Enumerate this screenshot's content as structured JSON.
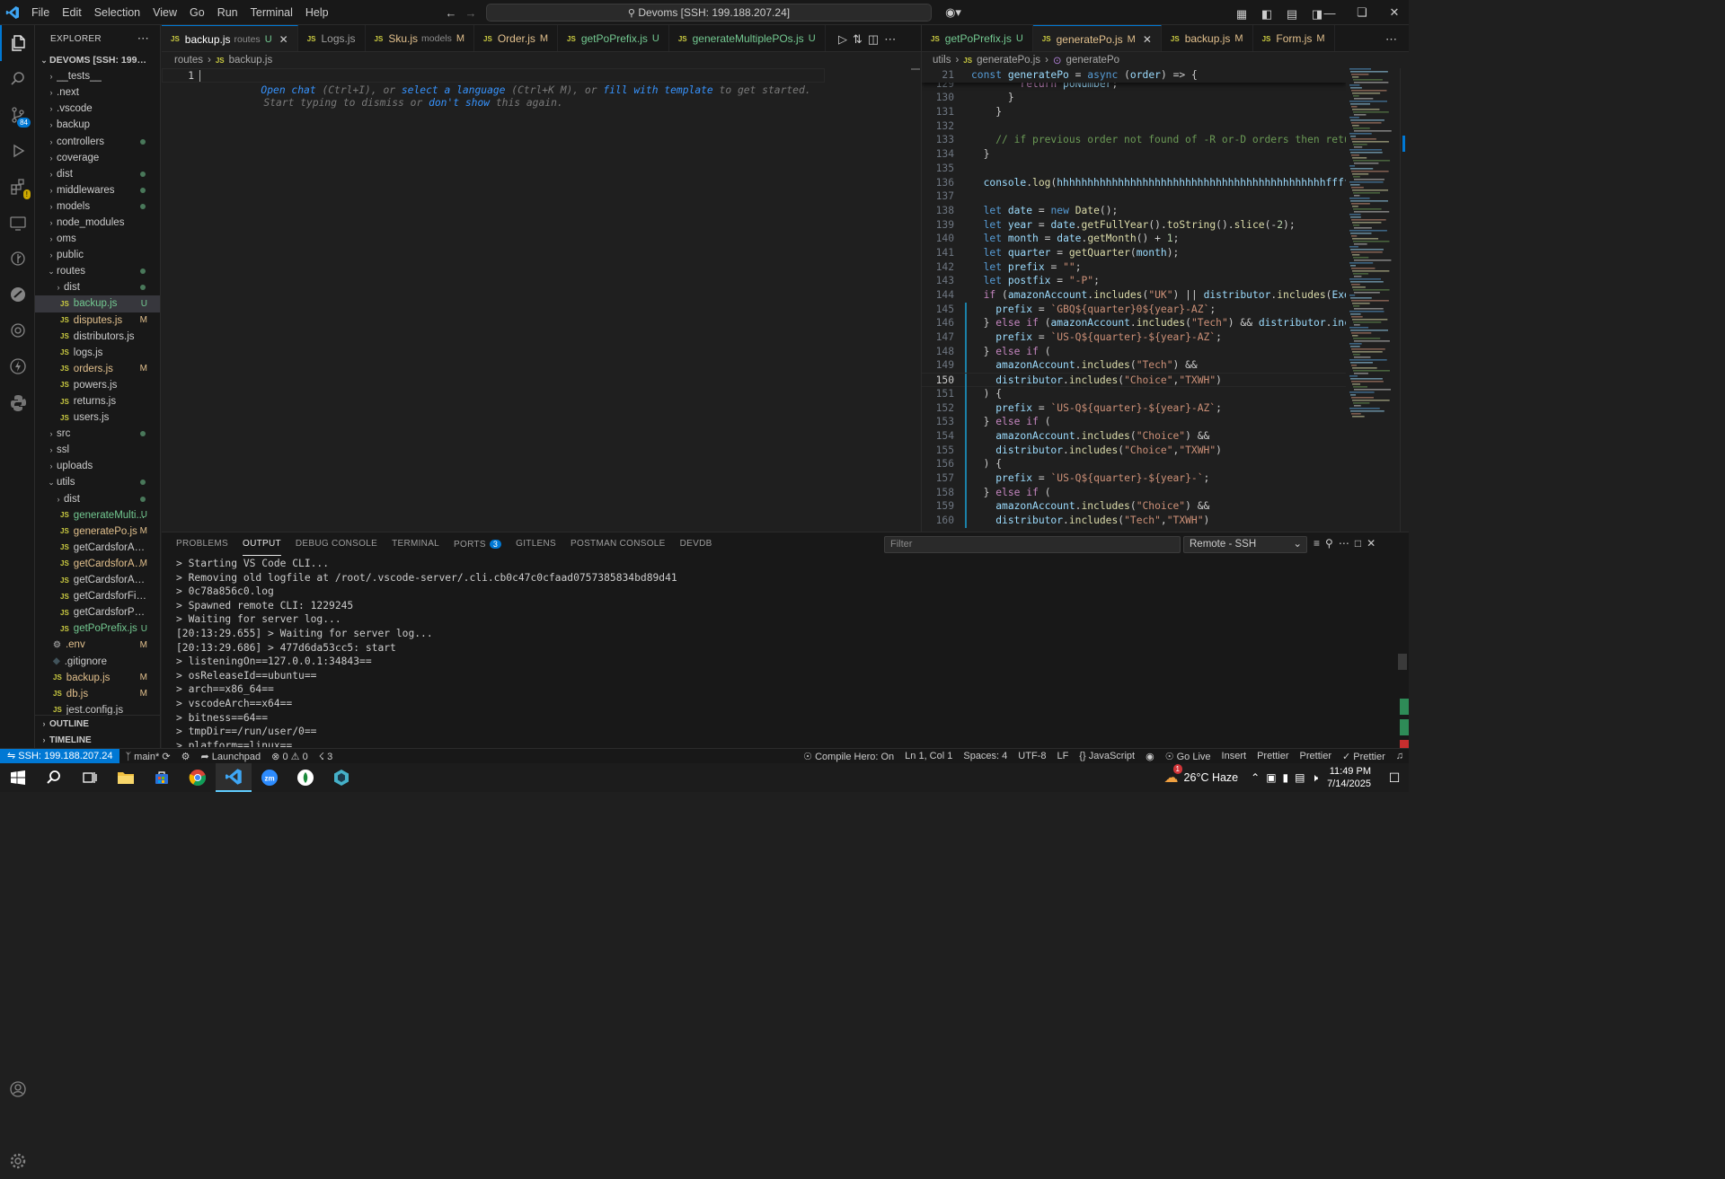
{
  "titlebar": {
    "menu": [
      "File",
      "Edit",
      "Selection",
      "View",
      "Go",
      "Run",
      "Terminal",
      "Help"
    ],
    "command_center": "Devoms [SSH: 199.188.207.24]"
  },
  "explorer": {
    "title": "EXPLORER",
    "root": "DEVOMS [SSH: 199.188.20...",
    "items": [
      {
        "label": "__tests__",
        "type": "folder",
        "indent": 0,
        "open": false,
        "status": ""
      },
      {
        "label": ".next",
        "type": "folder",
        "indent": 0,
        "open": false,
        "status": ""
      },
      {
        "label": ".vscode",
        "type": "folder",
        "indent": 0,
        "open": false,
        "status": ""
      },
      {
        "label": "backup",
        "type": "folder",
        "indent": 0,
        "open": false,
        "status": ""
      },
      {
        "label": "controllers",
        "type": "folder",
        "indent": 0,
        "open": false,
        "status": "dot"
      },
      {
        "label": "coverage",
        "type": "folder",
        "indent": 0,
        "open": false,
        "status": ""
      },
      {
        "label": "dist",
        "type": "folder",
        "indent": 0,
        "open": false,
        "status": "dot"
      },
      {
        "label": "middlewares",
        "type": "folder",
        "indent": 0,
        "open": false,
        "status": "dot"
      },
      {
        "label": "models",
        "type": "folder",
        "indent": 0,
        "open": false,
        "status": "dot"
      },
      {
        "label": "node_modules",
        "type": "folder",
        "indent": 0,
        "open": false,
        "status": ""
      },
      {
        "label": "oms",
        "type": "folder",
        "indent": 0,
        "open": false,
        "status": ""
      },
      {
        "label": "public",
        "type": "folder",
        "indent": 0,
        "open": false,
        "status": ""
      },
      {
        "label": "routes",
        "type": "folder",
        "indent": 0,
        "open": true,
        "status": "dot"
      },
      {
        "label": "dist",
        "type": "folder",
        "indent": 1,
        "open": false,
        "status": "dot"
      },
      {
        "label": "backup.js",
        "type": "js",
        "indent": 1,
        "status": "U",
        "selected": true
      },
      {
        "label": "disputes.js",
        "type": "js",
        "indent": 1,
        "status": "M"
      },
      {
        "label": "distributors.js",
        "type": "js",
        "indent": 1,
        "status": ""
      },
      {
        "label": "logs.js",
        "type": "js",
        "indent": 1,
        "status": ""
      },
      {
        "label": "orders.js",
        "type": "js",
        "indent": 1,
        "status": "M"
      },
      {
        "label": "powers.js",
        "type": "js",
        "indent": 1,
        "status": ""
      },
      {
        "label": "returns.js",
        "type": "js",
        "indent": 1,
        "status": ""
      },
      {
        "label": "users.js",
        "type": "js",
        "indent": 1,
        "status": ""
      },
      {
        "label": "src",
        "type": "folder",
        "indent": 0,
        "open": false,
        "status": "dot"
      },
      {
        "label": "ssl",
        "type": "folder",
        "indent": 0,
        "open": false,
        "status": ""
      },
      {
        "label": "uploads",
        "type": "folder",
        "indent": 0,
        "open": false,
        "status": ""
      },
      {
        "label": "utils",
        "type": "folder",
        "indent": 0,
        "open": true,
        "status": "dot"
      },
      {
        "label": "dist",
        "type": "folder",
        "indent": 1,
        "open": false,
        "status": "dot"
      },
      {
        "label": "generateMulti...",
        "type": "js",
        "indent": 1,
        "status": "U"
      },
      {
        "label": "generatePo.js",
        "type": "js",
        "indent": 1,
        "status": "M"
      },
      {
        "label": "getCardsforAccount.js",
        "type": "js",
        "indent": 1,
        "status": ""
      },
      {
        "label": "getCardsforAd...",
        "type": "js",
        "indent": 1,
        "status": "M"
      },
      {
        "label": "getCardsforAmazon.js",
        "type": "js",
        "indent": 1,
        "status": ""
      },
      {
        "label": "getCardsforFinance.js",
        "type": "js",
        "indent": 1,
        "status": ""
      },
      {
        "label": "getCardsforPurchasi...",
        "type": "js",
        "indent": 1,
        "status": ""
      },
      {
        "label": "getPoPrefix.js",
        "type": "js",
        "indent": 1,
        "status": "U"
      },
      {
        "label": ".env",
        "type": "gear",
        "indent": 0,
        "status": "M"
      },
      {
        "label": ".gitignore",
        "type": "git",
        "indent": 0,
        "status": ""
      },
      {
        "label": "backup.js",
        "type": "js",
        "indent": 0,
        "status": "M"
      },
      {
        "label": "db.js",
        "type": "js",
        "indent": 0,
        "status": "M"
      },
      {
        "label": "jest.config.js",
        "type": "js",
        "indent": 0,
        "status": ""
      }
    ],
    "outline": "OUTLINE",
    "timeline": "TIMELINE"
  },
  "editor_left": {
    "tabs": [
      {
        "name": "backup.js",
        "desc": "routes",
        "status": "U",
        "active": true
      },
      {
        "name": "Logs.js",
        "desc": "",
        "status": "",
        "active": false
      },
      {
        "name": "Sku.js",
        "desc": "models",
        "status": "M",
        "active": false
      },
      {
        "name": "Order.js",
        "desc": "",
        "status": "M",
        "active": false
      },
      {
        "name": "getPoPrefix.js",
        "desc": "",
        "status": "U",
        "active": false
      },
      {
        "name": "generateMultiplePOs.js",
        "desc": "",
        "status": "U",
        "active": false
      }
    ],
    "breadcrumb": [
      "routes",
      "backup.js"
    ],
    "hint": {
      "line_number": "1",
      "part1": "Open chat",
      "part2": " (Ctrl+I), or ",
      "part3": "select a language",
      "part4": " (Ctrl+K M), or ",
      "part5": "fill with template",
      "part6": " to get started.",
      "line2a": "Start typing to dismiss or ",
      "line2b": "don't show",
      "line2c": " this again."
    }
  },
  "editor_right": {
    "tabs": [
      {
        "name": "getPoPrefix.js",
        "status": "U",
        "active": false
      },
      {
        "name": "generatePo.js",
        "status": "M",
        "active": true
      },
      {
        "name": "backup.js",
        "status": "M",
        "active": false
      },
      {
        "name": "Form.js",
        "status": "M",
        "active": false
      }
    ],
    "breadcrumb": [
      "utils",
      "generatePo.js",
      "generatePo"
    ],
    "sticky": {
      "num": "21",
      "text": "const generatePo = async (order) => {"
    },
    "current_line": "150",
    "lines": [
      {
        "n": "129",
        "t": "        return poNumber;"
      },
      {
        "n": "130",
        "t": "      }"
      },
      {
        "n": "131",
        "t": "    }"
      },
      {
        "n": "132",
        "t": ""
      },
      {
        "n": "133",
        "t": "    // if previous order not found of -R or-D orders then return t"
      },
      {
        "n": "134",
        "t": "  }"
      },
      {
        "n": "135",
        "t": ""
      },
      {
        "n": "136",
        "t": "  console.log(\"hhhhhhhhhhhhhhhhhhhhhhhhhhhhhhhhhhhhhhhhhhhhffffffff"
      },
      {
        "n": "137",
        "t": ""
      },
      {
        "n": "138",
        "t": "  let date = new Date();"
      },
      {
        "n": "139",
        "t": "  let year = date.getFullYear().toString().slice(-2);"
      },
      {
        "n": "140",
        "t": "  let month = date.getMonth() + 1;"
      },
      {
        "n": "141",
        "t": "  let quarter = getQuarter(month);"
      },
      {
        "n": "142",
        "t": "  let prefix = \"\";"
      },
      {
        "n": "143",
        "t": "  let postfix = \"-P\";"
      },
      {
        "n": "144",
        "t": "  if (amazonAccount.includes(\"UK\") || distributor.includes(\"Exerti"
      },
      {
        "n": "145",
        "t": "    prefix = `GBQ${quarter}0${year}-AZ`;"
      },
      {
        "n": "146",
        "t": "  } else if (amazonAccount.includes(\"Tech\") && distributor.include"
      },
      {
        "n": "147",
        "t": "    prefix = `US-Q${quarter}-${year}-AZ`;"
      },
      {
        "n": "148",
        "t": "  } else if ("
      },
      {
        "n": "149",
        "t": "    amazonAccount.includes(\"Tech\") &&"
      },
      {
        "n": "150",
        "t": "    distributor.includes(\"Choice\",\"TXWH\")"
      },
      {
        "n": "151",
        "t": "  ) {"
      },
      {
        "n": "152",
        "t": "    prefix = `US-Q${quarter}-${year}-AZ`;"
      },
      {
        "n": "153",
        "t": "  } else if ("
      },
      {
        "n": "154",
        "t": "    amazonAccount.includes(\"Choice\") &&"
      },
      {
        "n": "155",
        "t": "    distributor.includes(\"Choice\",\"TXWH\")"
      },
      {
        "n": "156",
        "t": "  ) {"
      },
      {
        "n": "157",
        "t": "    prefix = `US-Q${quarter}-${year}-`;"
      },
      {
        "n": "158",
        "t": "  } else if ("
      },
      {
        "n": "159",
        "t": "    amazonAccount.includes(\"Choice\") &&"
      },
      {
        "n": "160",
        "t": "    distributor.includes(\"Tech\",\"TXWH\")"
      }
    ]
  },
  "panel": {
    "tabs": [
      "PROBLEMS",
      "OUTPUT",
      "DEBUG CONSOLE",
      "TERMINAL",
      "PORTS",
      "GITLENS",
      "POSTMAN CONSOLE",
      "DEVDB"
    ],
    "active_tab": "OUTPUT",
    "ports_badge": "3",
    "filter_placeholder": "Filter",
    "channel": "Remote - SSH",
    "lines": [
      "> Starting VS Code CLI...",
      "> Removing old logfile at /root/.vscode-server/.cli.cb0c47c0cfaad0757385834bd89d41",
      "> 0c78a856c0.log",
      "> Spawned remote CLI: 1229245",
      "> Waiting for server log...",
      "[20:13:29.655] > Waiting for server log...",
      "[20:13:29.686] > 477d6da53cc5: start",
      "> listeningOn==127.0.0.1:34843==",
      "> osReleaseId==ubuntu==",
      "> arch==x86_64==",
      "> vscodeArch==x64==",
      "> bitness==64==",
      "> tmpDir==/run/user/0==",
      "> platform==linux=="
    ]
  },
  "statusbar": {
    "remote": "SSH: 199.188.207.24",
    "branch": "main*",
    "launchpad": "Launchpad",
    "errors": "0",
    "warnings": "0",
    "ports": "3",
    "compile_hero": "Compile Hero: On",
    "position": "Ln 1, Col 1",
    "spaces": "Spaces: 4",
    "encoding": "UTF-8",
    "eol": "LF",
    "language": "JavaScript",
    "golive": "Go Live",
    "insert": "Insert",
    "prettier1": "Prettier",
    "prettier2": "Prettier",
    "prettier3": "Prettier"
  },
  "taskbar": {
    "weather": "26°C Haze",
    "weather_badge": "1",
    "time": "11:49 PM",
    "date": "7/14/2025"
  },
  "colors": {
    "accent": "#0078d4",
    "modified": "#e2c08d",
    "untracked": "#73c991",
    "remote_badge": "#0078d4"
  }
}
